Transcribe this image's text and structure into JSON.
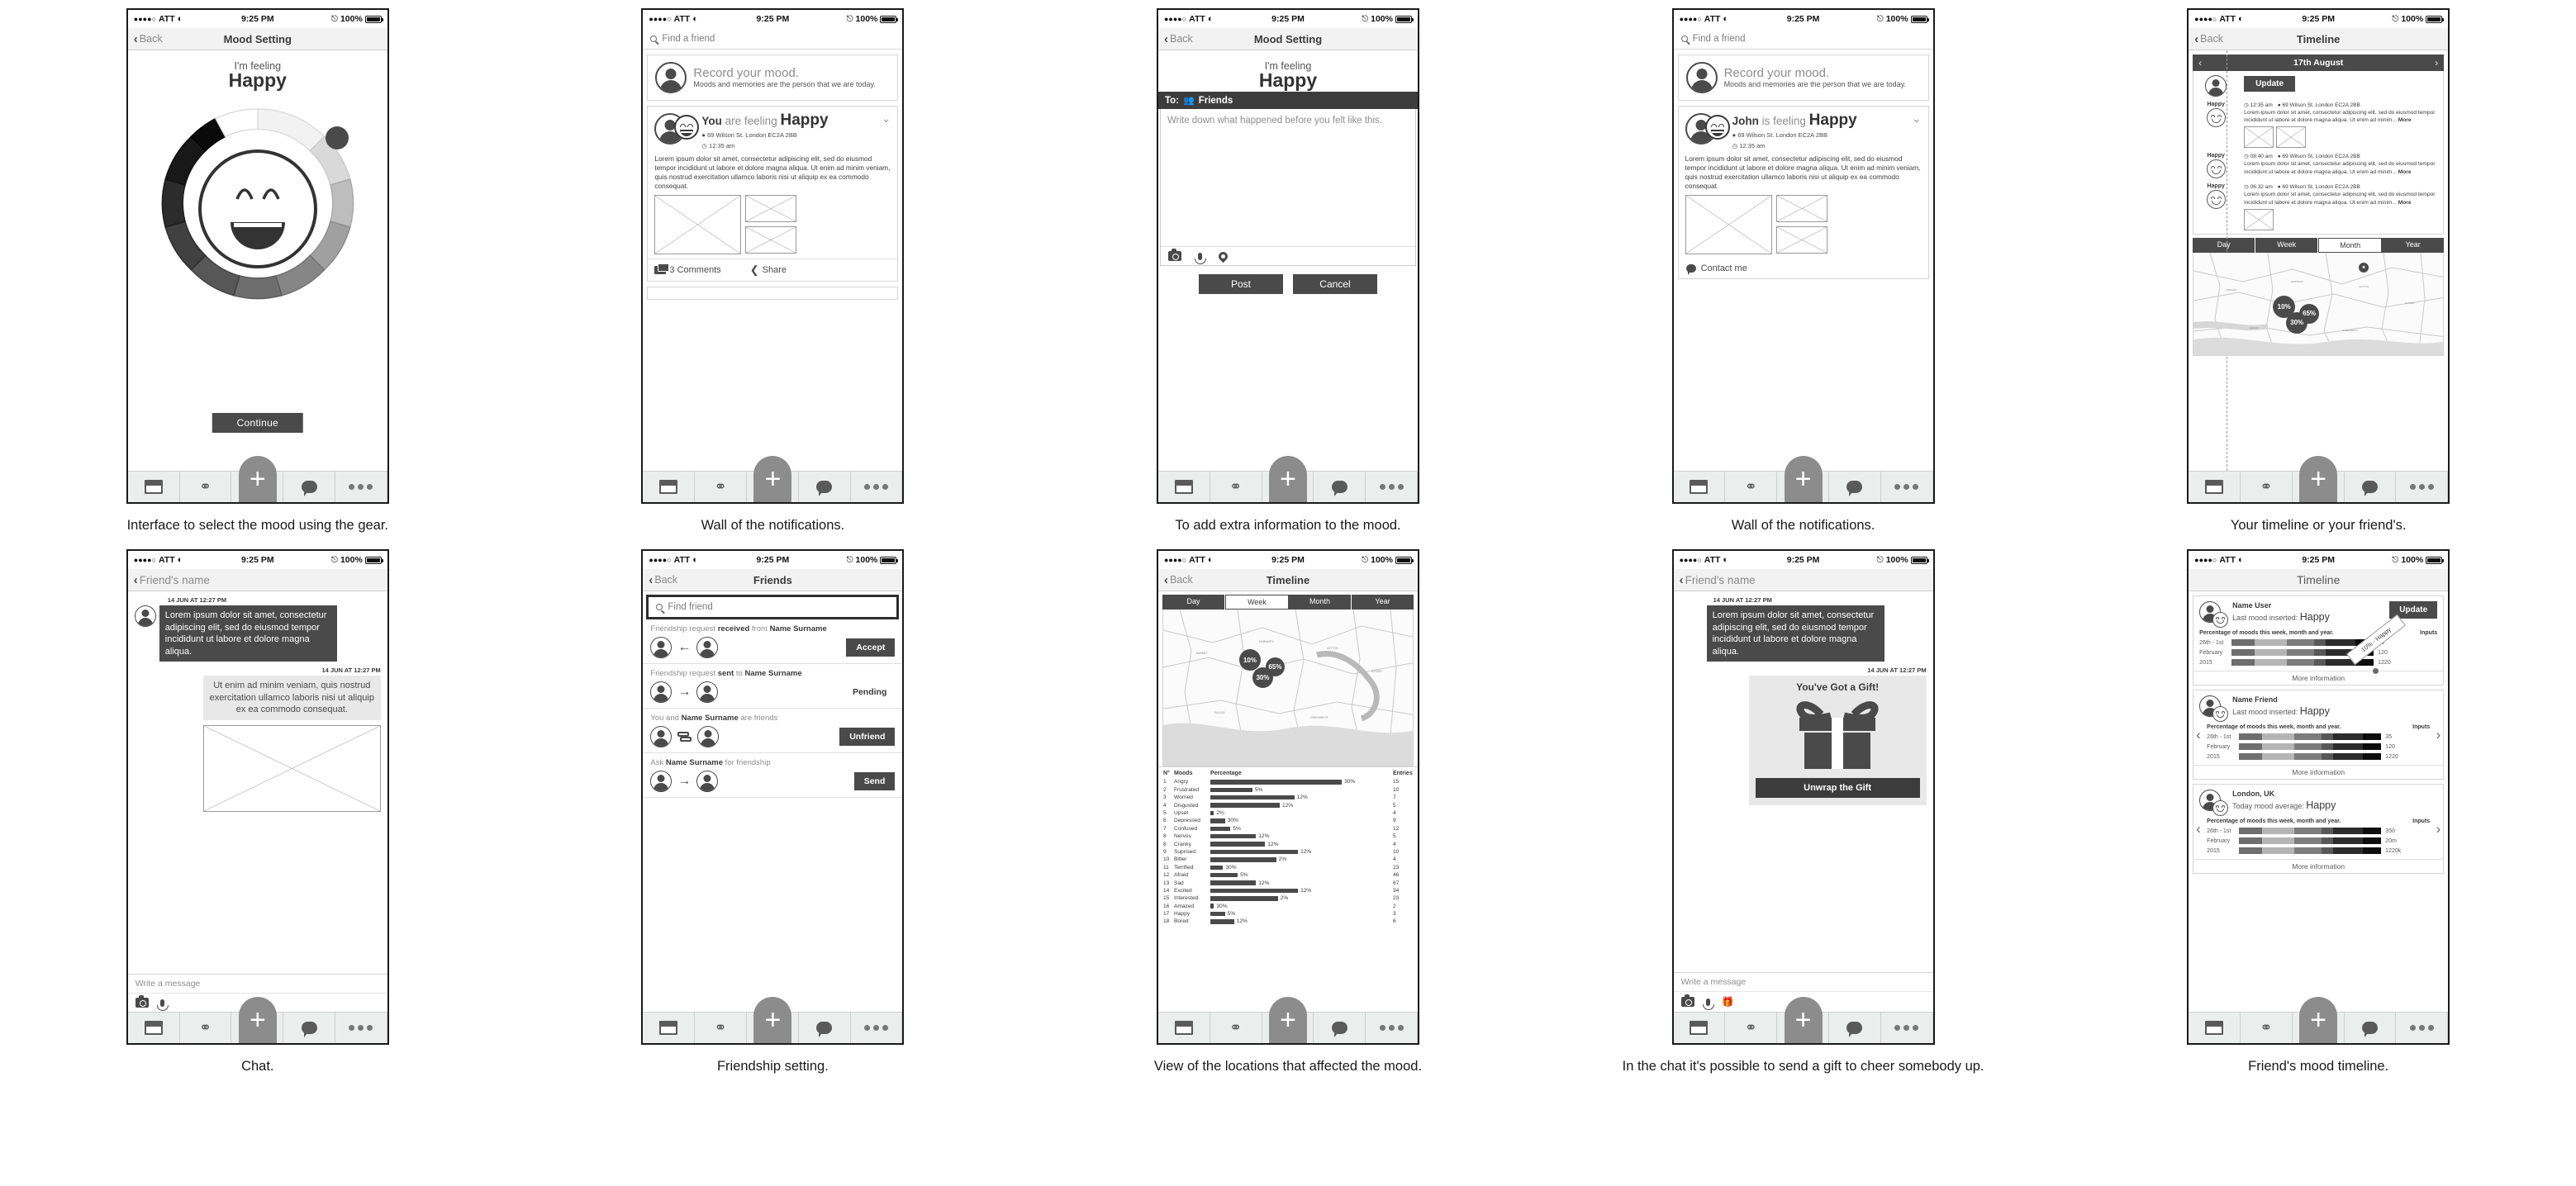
{
  "status_bar": {
    "carrier": "ATT",
    "dots": "●●●●○",
    "time": "9:25 PM",
    "battery": "100%"
  },
  "tabbar": {
    "window": "window-icon",
    "network": "network-icon",
    "plus": "+",
    "chat": "chat-icon",
    "more": "more-icon"
  },
  "screens": [
    {
      "id": "mood-gear",
      "caption": "Interface to select the mood using the gear.",
      "nav": {
        "back": "Back",
        "title": "Mood Setting"
      },
      "feeling_label": "I'm feeling",
      "mood": "Happy",
      "continue_label": "Continue"
    },
    {
      "id": "wall-you",
      "caption": "Wall of the notifications.",
      "search_placeholder": "Find a friend",
      "record": {
        "title": "Record your mood.",
        "subtitle": "Moods and memories are the person that we are today."
      },
      "post": {
        "name": "You",
        "verb": "are feeling",
        "mood": "Happy",
        "location": "69 Wilson St. London EC2A 2BB",
        "time": "12:35 am",
        "body": "Lorem ipsum dolor sit amet, consectetur adipiscing elit, sed do eiusmod tempor incididunt ut labore et dolore magna aliqua. Ut enim ad minim veniam, quis nostrud exercitation ullamco laboris nisi ut aliquip ex ea commodo consequat.",
        "comments": "3 Comments",
        "share": "Share"
      }
    },
    {
      "id": "compose",
      "caption": "To add extra information to the mood.",
      "nav": {
        "back": "Back",
        "title": "Mood Setting"
      },
      "feeling_label": "I'm feeling",
      "mood": "Happy",
      "to_label": "To:",
      "to_value": "Friends",
      "compose_placeholder": "Write down what happened before you felt like this.",
      "post_label": "Post",
      "cancel_label": "Cancel"
    },
    {
      "id": "wall-john",
      "caption": "Wall of the notifications.",
      "search_placeholder": "Find a friend",
      "record": {
        "title": "Record your mood.",
        "subtitle": "Moods and memories are the person that we are today."
      },
      "post": {
        "name": "John",
        "verb": "is feeling",
        "mood": "Happy",
        "location": "69 Wilson St. London EC2A 2BB",
        "time": "12:35 am",
        "body": "Lorem ipsum dolor sit amet, consectetur adipiscing elit, sed do eiusmod tempor incididunt ut labore et dolore magna aliqua. Ut enim ad minim veniam, quis nostrud exercitation ullamco laboris nisi ut aliquip ex ea commodo consequat.",
        "contact": "Contact me"
      }
    },
    {
      "id": "timeline",
      "caption": "Your timeline or your friend's.",
      "nav": {
        "back": "Back",
        "title": "Timeline"
      },
      "date": "17th August",
      "update_label": "Update",
      "entries": [
        {
          "mood": "Happy",
          "time": "12:35 am",
          "location": "69 Wilson St, London EC2A 2BB",
          "text": "Lorem ipsum dolor sit amet, consectetur adipiscing elit, sed do eiusmod tempor incididunt ut labore et dolore magna aliqua. Ut enim ad minim...",
          "more": "More",
          "has_photos": true
        },
        {
          "mood": "Happy",
          "time": "08:40 am",
          "location": "69 Wilson St, London EC2A 2BB",
          "text": "Lorem ipsum dolor sit amet, consectetur adipiscing elit, sed do eiusmod tempor incididunt ut labore et dolore magna aliqua. Ut enim ad minim...",
          "more": "More",
          "has_photos": false
        },
        {
          "mood": "Happy",
          "time": "06:32 am",
          "location": "69 Wilson St, London EC2A 2BB",
          "text": "Lorem ipsum dolor sit amet, consectetur adipiscing elit, sed do eiusmod tempor incididunt ut labore et dolore magna aliqua. Ut enim ad minim...",
          "more": "More",
          "has_photos": true
        }
      ],
      "segments": [
        "Day",
        "Week",
        "Month",
        "Year"
      ],
      "segment_active": "Month",
      "map_markers": [
        "10%",
        "65%",
        "30%"
      ]
    },
    {
      "id": "chat",
      "caption": "Chat.",
      "nav": {
        "back": "Friend's name"
      },
      "messages": [
        {
          "side": "left",
          "time": "14 JUN AT 12:27 PM",
          "text": "Lorem ipsum dolor sit amet, consectetur adipiscing elit, sed do eiusmod tempor incididunt ut labore et dolore magna aliqua."
        },
        {
          "side": "right",
          "time": "14 JUN AT 12:27 PM",
          "text": "Ut enim ad minim veniam, quis nostrud exercitation ullamco laboris nisi ut aliquip ex ea commodo consequat."
        }
      ],
      "input_placeholder": "Write a message"
    },
    {
      "id": "friends",
      "caption": "Friendship setting.",
      "nav": {
        "back": "Back",
        "title": "Friends"
      },
      "search_placeholder": "Find friend",
      "rows": [
        {
          "pre": "Friendship request ",
          "strong": "received",
          "post": " from ",
          "name": "Name Surname",
          "icon": "arrow-left-icon",
          "action": "Accept",
          "action_type": "button"
        },
        {
          "pre": "Friendship request ",
          "strong": "sent",
          "post": " to ",
          "name": "Name Surname",
          "icon": "arrow-right-icon",
          "action": "Pending",
          "action_type": "status"
        },
        {
          "pre": "You and ",
          "strong": "Name Surname",
          "post": " are friends",
          "name": "",
          "icon": "swap-icon",
          "action": "Unfriend",
          "action_type": "button"
        },
        {
          "pre": "Ask ",
          "strong": "Name Surname",
          "post": " for friendship",
          "name": "",
          "icon": "arrow-right-icon",
          "action": "Send",
          "action_type": "button"
        }
      ]
    },
    {
      "id": "locations",
      "caption": "View of the locations that affected the mood.",
      "nav": {
        "back": "Back",
        "title": "Timeline"
      },
      "segments": [
        "Day",
        "Week",
        "Month",
        "Year"
      ],
      "segment_active": "Week",
      "map_markers": [
        "10%",
        "65%",
        "30%"
      ]
    },
    {
      "id": "gift",
      "caption": "In the chat it's possible to send a gift to cheer somebody up.",
      "nav": {
        "back": "Friend's name"
      },
      "message": {
        "time": "14 JUN AT 12:27 PM",
        "text": "Lorem ipsum dolor sit amet, consectetur adipiscing elit, sed do eiusmod tempor incididunt ut labore et dolore magna aliqua."
      },
      "gift": {
        "time": "14 JUN AT 12:27 PM",
        "title": "You've Got a Gift!",
        "button": "Unwrap the Gift"
      },
      "input_placeholder": "Write a message"
    },
    {
      "id": "friend-timeline",
      "caption": "Friend's mood timeline.",
      "nav": {
        "title": "Timeline"
      },
      "ribbon": "10% - Happy",
      "cards": [
        {
          "name": "Name User",
          "sub_label": "Last mood inserted:",
          "mood": "Happy",
          "update_label": "Update",
          "stats_label": "Percentage of moods this week, month and year.",
          "inputs_label": "Inputs",
          "rows": [
            {
              "k": "26th - 1st",
              "v": "35"
            },
            {
              "k": "February",
              "v": "120"
            },
            {
              "k": "2015",
              "v": "1220"
            }
          ],
          "more": "More information",
          "arrows": false,
          "ribbon": true
        },
        {
          "name": "Name Friend",
          "sub_label": "Last mood inserted:",
          "mood": "Happy",
          "stats_label": "Percentage of moods this week, month and year.",
          "inputs_label": "Inputs",
          "rows": [
            {
              "k": "26th - 1st",
              "v": "35"
            },
            {
              "k": "February",
              "v": "120"
            },
            {
              "k": "2015",
              "v": "1220"
            }
          ],
          "more": "More information",
          "arrows": true,
          "ribbon": false
        },
        {
          "name": "London, UK",
          "sub_label": "Today mood average:",
          "mood": "Happy",
          "stats_label": "Percentage of moods this week, month and year.",
          "inputs_label": "Inputs",
          "rows": [
            {
              "k": "26th - 1st",
              "v": "350"
            },
            {
              "k": "February",
              "v": "20m"
            },
            {
              "k": "2015",
              "v": "1220k"
            }
          ],
          "more": "More information",
          "arrows": true,
          "ribbon": false
        }
      ]
    }
  ],
  "chart_data": {
    "type": "bar",
    "title": "Moods",
    "columns": [
      "N°",
      "Moods",
      "Percentage",
      "Entries"
    ],
    "xlabel": "Percentage",
    "ylabel": "Moods",
    "xlim": [
      0,
      100
    ],
    "categories": [
      "Angry",
      "Frustrated",
      "Worried",
      "Disgusted",
      "Upset",
      "Depressed",
      "Confused",
      "Nervos",
      "Cranky",
      "Suprised",
      "Bitter",
      "Terrified",
      "Afraid",
      "Sad",
      "Excited",
      "Interested",
      "Amazed",
      "Happy",
      "Bored"
    ],
    "numbers": [
      "1",
      "2",
      "3",
      "4",
      "5",
      "6",
      "7",
      "8",
      "8",
      "9",
      "10",
      "11",
      "12",
      "13",
      "14",
      "15",
      "16",
      "17",
      "18"
    ],
    "labels": [
      "30%",
      "5%",
      "12%",
      "12%",
      "2%",
      "30%",
      "5%",
      "12%",
      "12%",
      "12%",
      "2%",
      "30%",
      "5%",
      "12%",
      "12%",
      "2%",
      "30%",
      "5%",
      "12%"
    ],
    "values": [
      72,
      23,
      46,
      38,
      2,
      8,
      11,
      25,
      30,
      48,
      36,
      7,
      15,
      25,
      48,
      37,
      2,
      8,
      13
    ],
    "entries": [
      "15",
      "10",
      "7",
      "5",
      "4",
      "9",
      "12",
      "5",
      "4",
      "10",
      "4",
      "23",
      "46",
      "67",
      "34",
      "23",
      "2",
      "3",
      "6"
    ],
    "legend_position": "none",
    "grid": false
  }
}
